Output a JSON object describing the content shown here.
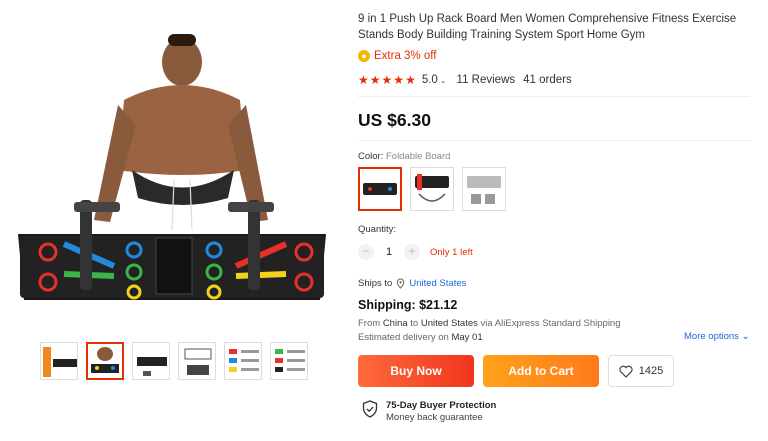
{
  "product": {
    "title": "9 in 1 Push Up Rack Board Men Women Comprehensive Fitness Exercise Stands Body Building Training System Sport Home Gym",
    "discount": "Extra 3% off",
    "rating_stars": 5,
    "rating_value": "5.0",
    "reviews": "11 Reviews",
    "orders": "41 orders",
    "price": "US $6.30"
  },
  "variant": {
    "color_label": "Color:",
    "color_value": "Foldable Board",
    "selected_index": 0
  },
  "quantity": {
    "label": "Quantity:",
    "minus": "−",
    "value": "1",
    "plus": "+",
    "stock": "Only 1 left"
  },
  "shipping": {
    "ships_to_label": "Ships to",
    "ships_to_country": "United States",
    "cost": "Shipping: $21.12",
    "from_prefix": "From",
    "from_country": "China",
    "to_prefix": "to",
    "to_country": "United States",
    "via": "via AliExpress Standard Shipping",
    "delivery_prefix": "Estimated delivery on",
    "delivery_date": "May 01",
    "more_options": "More options"
  },
  "actions": {
    "buy_now": "Buy Now",
    "add_to_cart": "Add to Cart",
    "wishlist_count": "1425"
  },
  "protection": {
    "title": "75-Day Buyer Protection",
    "subtitle": "Money back guarantee"
  },
  "gallery": {
    "selected_thumb": 1,
    "thumb_count": 6
  },
  "colors": {
    "accent": "#e62e04",
    "link": "#1a66d6",
    "buy_now": "#f0361d",
    "add_to_cart": "#ff8c1a"
  }
}
